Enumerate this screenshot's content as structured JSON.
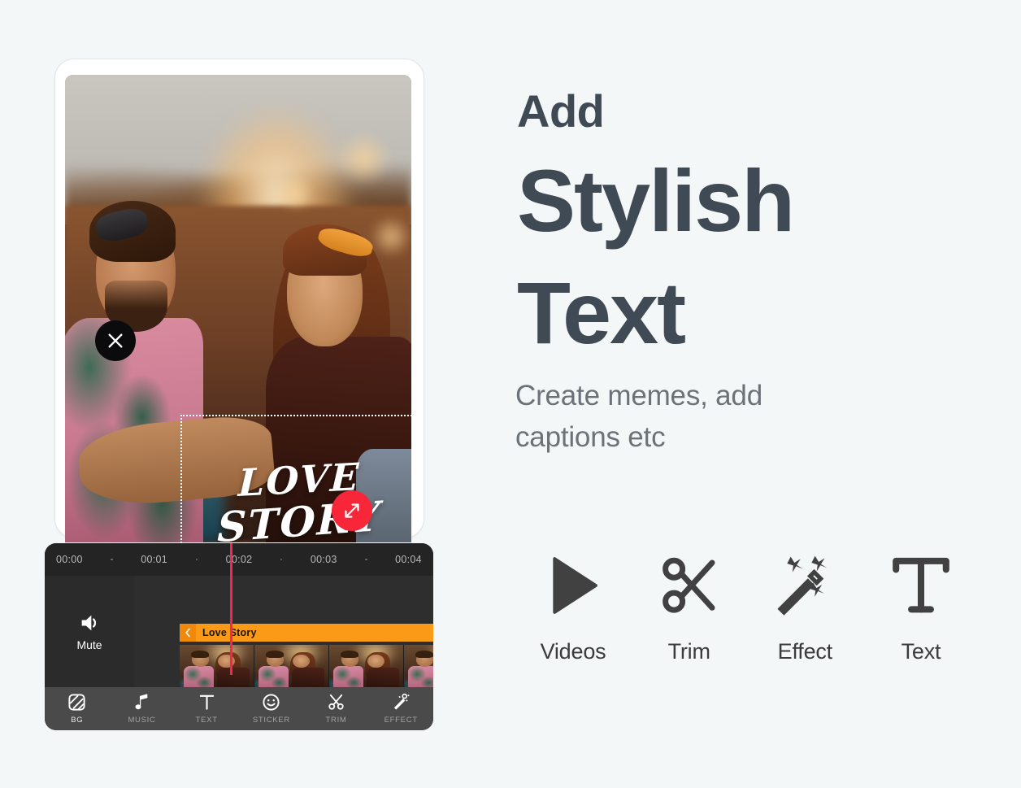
{
  "page": {
    "background_color": "#f4f7f8",
    "accent_red": "#f72638",
    "accent_orange": "#fb9a16",
    "playhead_color": "#f72651",
    "heading_color": "#3f4a54",
    "subhead_color": "#6b7278"
  },
  "promo": {
    "eyebrow": "Add",
    "headline_line1": "Stylish",
    "headline_line2": "Text",
    "subhead_line1": "Create memes, add",
    "subhead_line2": "captions etc"
  },
  "features": [
    {
      "label": "Videos",
      "icon": "play-icon"
    },
    {
      "label": "Trim",
      "icon": "scissors-icon"
    },
    {
      "label": "Effect",
      "icon": "magic-wand-icon"
    },
    {
      "label": "Text",
      "icon": "text-t-icon"
    }
  ],
  "editor": {
    "text_overlay": {
      "line1": "LOVE",
      "line2": "STORY",
      "close_icon": "close-x-icon",
      "resize_icon": "resize-diagonal-icon"
    },
    "timeline": {
      "ruler_ticks": [
        "00:00",
        "00:01",
        "00:02",
        "00:03",
        "00:04"
      ],
      "playhead_time": "00:02",
      "mute": {
        "label": "Mute",
        "icon": "speaker-icon"
      },
      "text_track": {
        "title": "Love Story",
        "handle_icon": "chevron-left-icon"
      },
      "thumbnail_count": 4
    },
    "toolbar": [
      {
        "label": "BG",
        "icon": "bg-striped-square-icon",
        "active": true
      },
      {
        "label": "MUSIC",
        "icon": "music-note-icon",
        "active": false
      },
      {
        "label": "TEXT",
        "icon": "text-t-icon",
        "active": false
      },
      {
        "label": "STICKER",
        "icon": "smiley-icon",
        "active": false
      },
      {
        "label": "TRIM",
        "icon": "scissors-icon",
        "active": false
      },
      {
        "label": "EFFECT",
        "icon": "magic-wand-icon",
        "active": false
      }
    ]
  }
}
